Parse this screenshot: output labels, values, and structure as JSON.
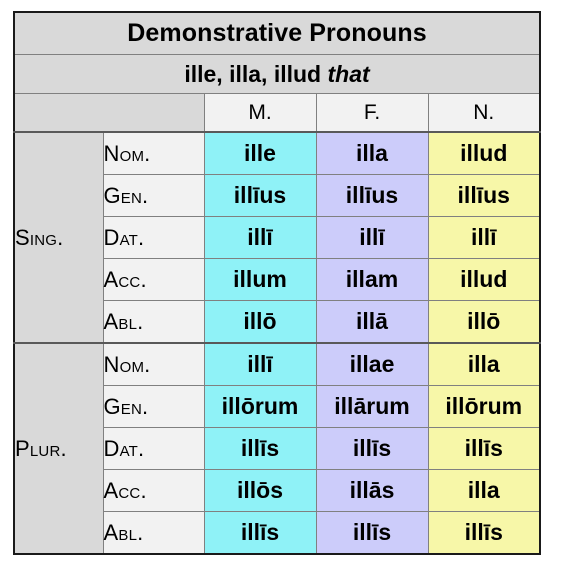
{
  "table": {
    "title": "Demonstrative Pronouns",
    "subtitle_forms": "ille, illa, illud",
    "subtitle_gloss": "that",
    "gender_headers": [
      "M.",
      "F.",
      "N."
    ],
    "colors": {
      "masculine": "#8ff2f7",
      "feminine": "#ccccfa",
      "neuter": "#f7f7a8",
      "header_gray": "#d9d9d9",
      "label_light": "#f2f2f2",
      "border": "#808080",
      "outer_border": "#1a1a1a"
    },
    "blocks": [
      {
        "number": "Sing.",
        "rows": [
          {
            "case": "Nom.",
            "m": "ille",
            "f": "illa",
            "n": "illud"
          },
          {
            "case": "Gen.",
            "m": "illīus",
            "f": "illīus",
            "n": "illīus"
          },
          {
            "case": "Dat.",
            "m": "illī",
            "f": "illī",
            "n": "illī"
          },
          {
            "case": "Acc.",
            "m": "illum",
            "f": "illam",
            "n": "illud"
          },
          {
            "case": "Abl.",
            "m": "illō",
            "f": "illā",
            "n": "illō"
          }
        ]
      },
      {
        "number": "Plur.",
        "rows": [
          {
            "case": "Nom.",
            "m": "illī",
            "f": "illae",
            "n": "illa"
          },
          {
            "case": "Gen.",
            "m": "illōrum",
            "f": "illārum",
            "n": "illōrum"
          },
          {
            "case": "Dat.",
            "m": "illīs",
            "f": "illīs",
            "n": "illīs"
          },
          {
            "case": "Acc.",
            "m": "illōs",
            "f": "illās",
            "n": "illa"
          },
          {
            "case": "Abl.",
            "m": "illīs",
            "f": "illīs",
            "n": "illīs"
          }
        ]
      }
    ]
  }
}
